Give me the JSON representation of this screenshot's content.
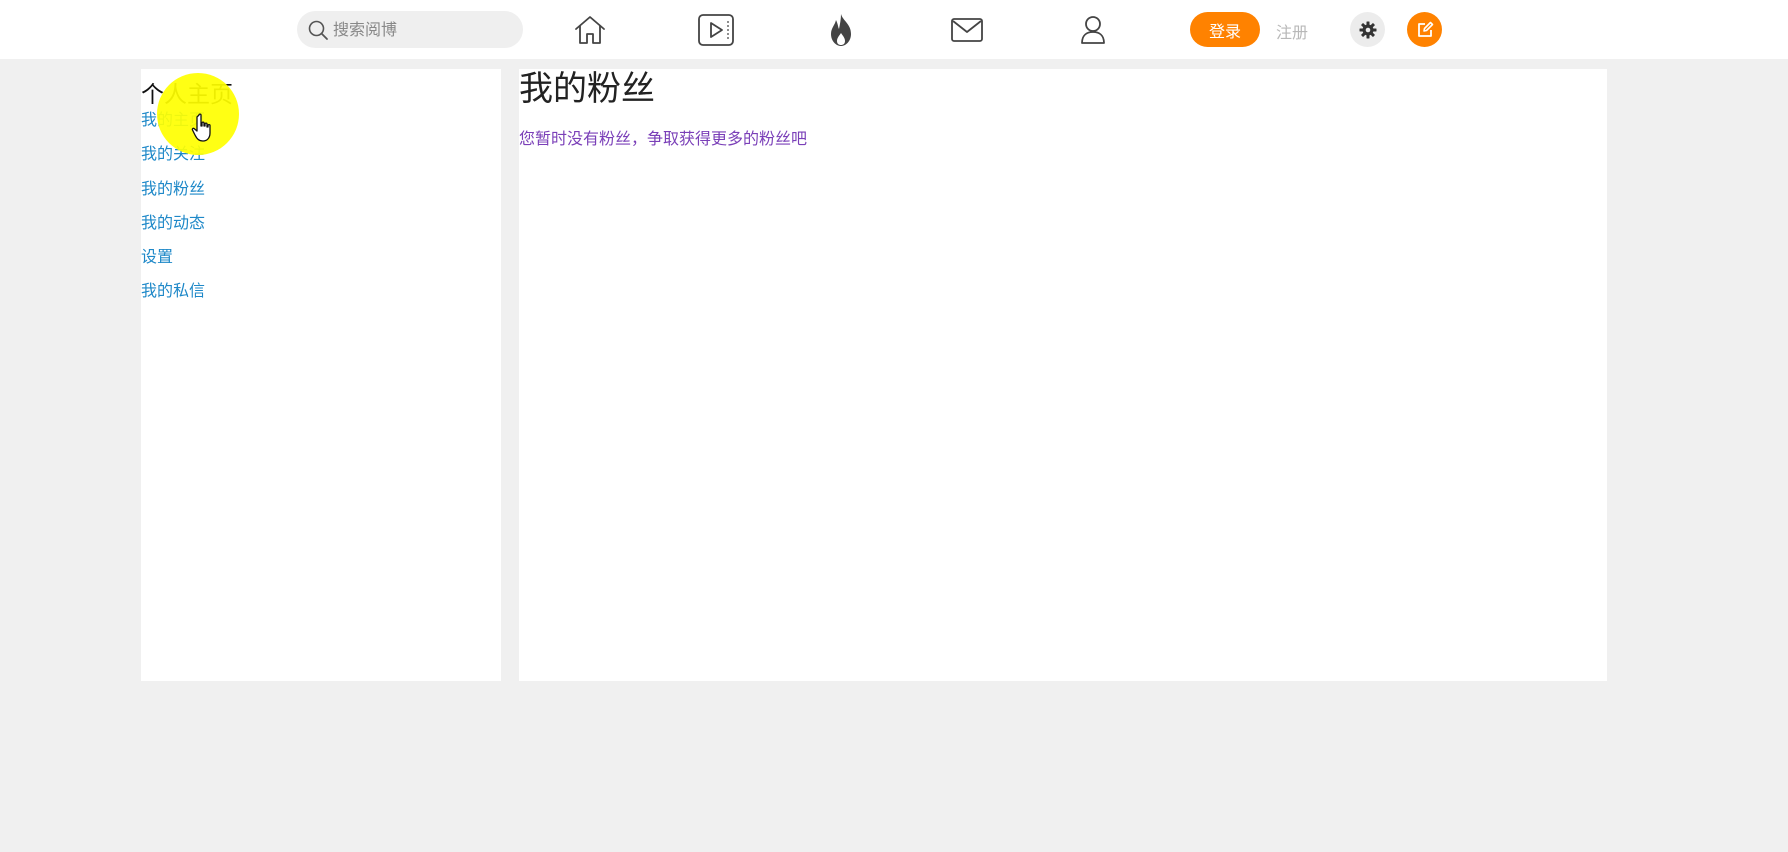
{
  "header": {
    "search": {
      "placeholder": "搜索阅博",
      "icon": "search-icon"
    },
    "nav_icons": [
      "home-icon",
      "video-icon",
      "fire-icon",
      "mail-icon",
      "user-icon"
    ],
    "login_label": "登录",
    "register_label": "注册",
    "settings_icon": "gear-icon",
    "compose_icon": "edit-icon"
  },
  "sidebar": {
    "title": "个人主页",
    "items": [
      {
        "label": "我的主页"
      },
      {
        "label": "我的关注"
      },
      {
        "label": "我的粉丝"
      },
      {
        "label": "我的动态"
      },
      {
        "label": "设置"
      },
      {
        "label": "我的私信"
      }
    ]
  },
  "main": {
    "title": "我的粉丝",
    "empty_message": "您暂时没有粉丝，争取获得更多的粉丝吧"
  },
  "colors": {
    "accent": "#ff8200",
    "link": "#1e88c8",
    "message": "#7a3fb8",
    "page_background": "#f0f0f0",
    "cursor_highlight": "#ffff00"
  }
}
